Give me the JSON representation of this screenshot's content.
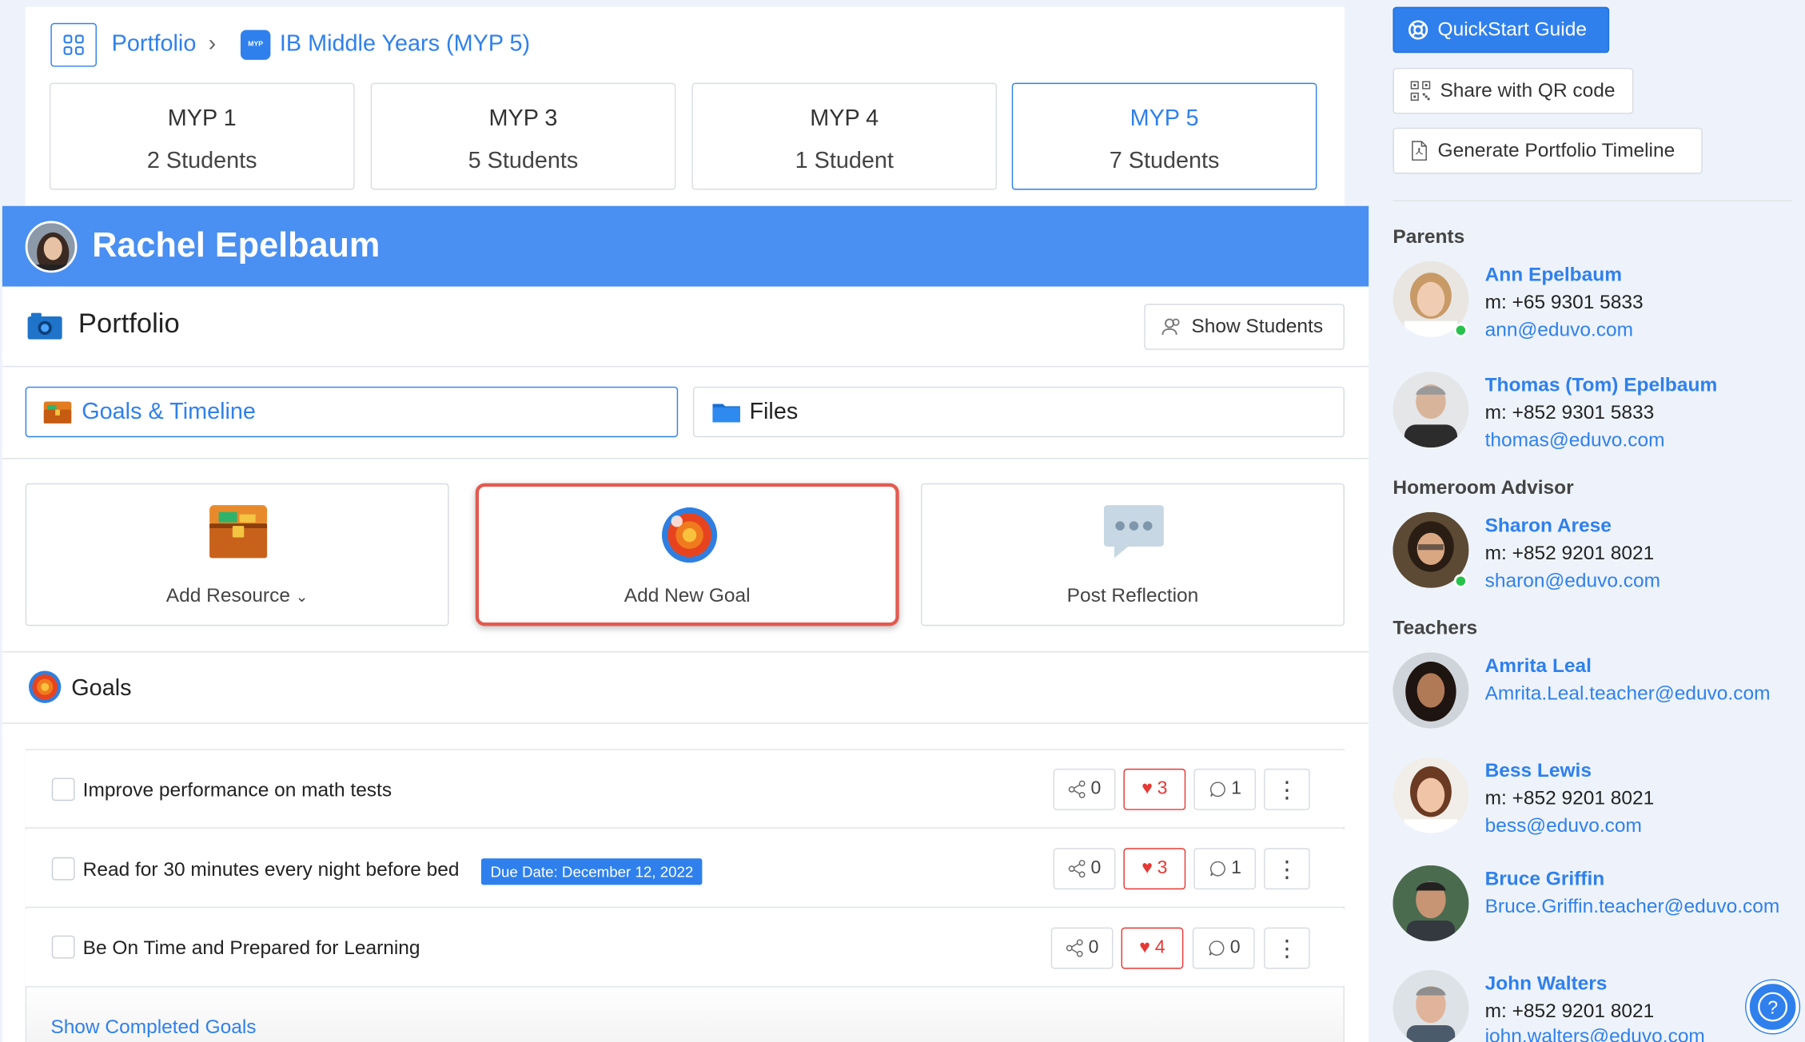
{
  "breadcrumb": {
    "portfolio": "Portfolio",
    "class": "IB Middle Years (MYP 5)",
    "badge": "MYP"
  },
  "years": [
    {
      "label": "MYP 1",
      "students": "2 Students"
    },
    {
      "label": "MYP 3",
      "students": "5 Students"
    },
    {
      "label": "MYP 4",
      "students": "1 Student"
    },
    {
      "label": "MYP 5",
      "students": "7 Students",
      "active": true
    }
  ],
  "student": {
    "name": "Rachel Epelbaum"
  },
  "portfolio": {
    "title": "Portfolio",
    "show_students": "Show Students"
  },
  "tabs": {
    "goals": "Goals & Timeline",
    "files": "Files"
  },
  "actions": {
    "add_resource": "Add Resource",
    "add_goal": "Add New Goal",
    "post_reflection": "Post Reflection"
  },
  "goals": {
    "title": "Goals",
    "items": [
      {
        "text": "Improve performance on math tests",
        "shares": "0",
        "likes": "3",
        "comments": "1"
      },
      {
        "text": "Read for 30 minutes every night before bed",
        "due": "Due Date: December 12, 2022",
        "shares": "0",
        "likes": "3",
        "comments": "1"
      },
      {
        "text": "Be On Time and Prepared for Learning",
        "shares": "0",
        "likes": "4",
        "comments": "0"
      }
    ],
    "show_completed": "Show Completed Goals"
  },
  "sidebar": {
    "quickstart": "QuickStart Guide",
    "qr": "Share with QR code",
    "timeline": "Generate Portfolio Timeline",
    "parents_label": "Parents",
    "homeroom_label": "Homeroom Advisor",
    "teachers_label": "Teachers",
    "parents": [
      {
        "name": "Ann Epelbaum",
        "phone": "m: +65 9301 5833",
        "email": "ann@eduvo.com"
      },
      {
        "name": "Thomas (Tom) Epelbaum",
        "phone": "m: +852 9301 5833",
        "email": "thomas@eduvo.com"
      }
    ],
    "homeroom": [
      {
        "name": "Sharon Arese",
        "phone": "m: +852 9201 8021",
        "email": "sharon@eduvo.com"
      }
    ],
    "teachers": [
      {
        "name": "Amrita Leal",
        "email": "Amrita.Leal.teacher@eduvo.com"
      },
      {
        "name": "Bess Lewis",
        "phone": "m: +852 9201 8021",
        "email": "bess@eduvo.com"
      },
      {
        "name": "Bruce Griffin",
        "email": "Bruce.Griffin.teacher@eduvo.com"
      },
      {
        "name": "John Walters",
        "phone": "m: +852 9201 8021",
        "email": "john.walters@eduvo.com"
      }
    ],
    "help": "?"
  },
  "colors": {
    "accent": "#2f80ed",
    "header": "#4a8ff2",
    "heart": "#e53935",
    "highlight": "#e35a50",
    "online": "#27c24c"
  }
}
